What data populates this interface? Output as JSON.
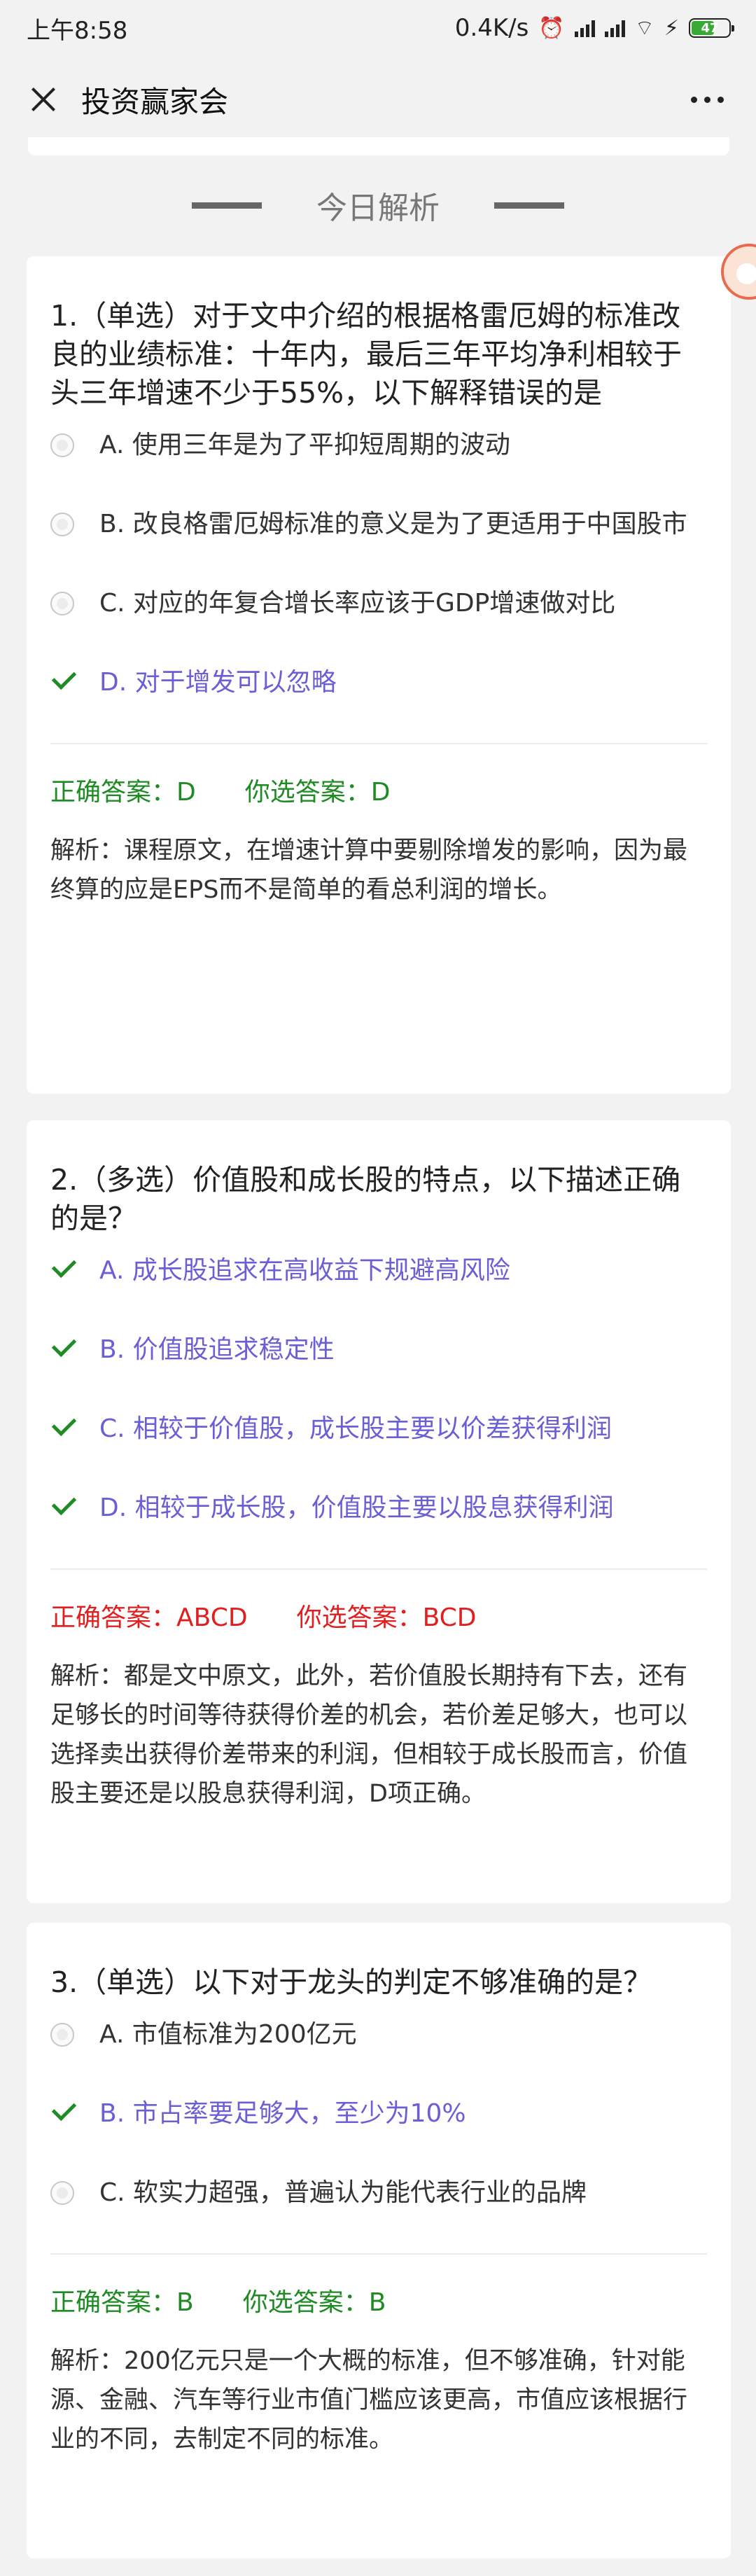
{
  "status_bar": {
    "time": "上午8:58",
    "net_speed": "0.4K/s",
    "battery": "47"
  },
  "nav": {
    "title": "投资赢家会"
  },
  "section_title": "今日解析",
  "questions": [
    {
      "title": "1.（单选）对于文中介绍的根据格雷厄姆的标准改良的业绩标准：十年内，最后三年平均净利相较于头三年增速不少于55%，以下解释错误的是",
      "options": [
        {
          "text": "A. 使用三年是为了平抑短周期的波动",
          "state": "radio"
        },
        {
          "text": "B. 改良格雷厄姆标准的意义是为了更适用于中国股市",
          "state": "radio"
        },
        {
          "text": "C. 对应的年复合增长率应该于GDP增速做对比",
          "state": "radio"
        },
        {
          "text": "D. 对于增发可以忽略",
          "state": "check"
        }
      ],
      "correct_answer": "正确答案：D",
      "your_answer": "你选答案：D",
      "answer_status": "ok",
      "analysis": "解析：课程原文，在增速计算中要剔除增发的影响，因为最终算的应是EPS而不是简单的看总利润的增长。"
    },
    {
      "title": "2.（多选）价值股和成长股的特点，以下描述正确的是？",
      "options": [
        {
          "text": "A. 成长股追求在高收益下规避高风险",
          "state": "check"
        },
        {
          "text": "B. 价值股追求稳定性",
          "state": "check"
        },
        {
          "text": "C. 相较于价值股，成长股主要以价差获得利润",
          "state": "check"
        },
        {
          "text": "D. 相较于成长股，价值股主要以股息获得利润",
          "state": "check"
        }
      ],
      "correct_answer": "正确答案：ABCD",
      "your_answer": "你选答案：BCD",
      "answer_status": "bad",
      "analysis": "解析：都是文中原文，此外，若价值股长期持有下去，还有足够长的时间等待获得价差的机会，若价差足够大，也可以选择卖出获得价差带来的利润，但相较于成长股而言，价值股主要还是以股息获得利润，D项正确。"
    },
    {
      "title": "3.（单选）以下对于龙头的判定不够准确的是？",
      "options": [
        {
          "text": "A. 市值标准为200亿元",
          "state": "radio"
        },
        {
          "text": "B. 市占率要足够大，至少为10%",
          "state": "check"
        },
        {
          "text": "C. 软实力超强，普遍认为能代表行业的品牌",
          "state": "radio"
        }
      ],
      "correct_answer": "正确答案：B",
      "your_answer": "你选答案：B",
      "answer_status": "ok",
      "analysis": "解析：200亿元只是一个大概的标准，但不够准确，针对能源、金融、汽车等行业市值门槛应该更高，市值应该根据行业的不同，去制定不同的标准。"
    }
  ]
}
